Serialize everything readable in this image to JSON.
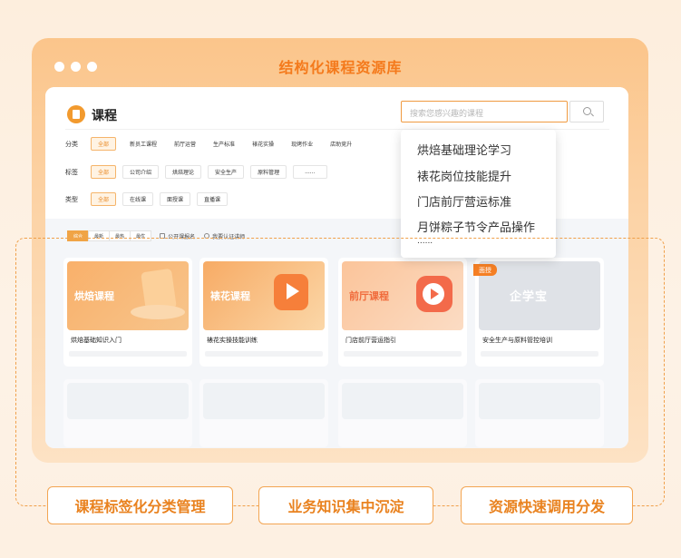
{
  "frame": {
    "title": "结构化课程资源库"
  },
  "header": {
    "title": "课程",
    "search_placeholder": "搜索您感兴趣的课程"
  },
  "filters": [
    {
      "label": "分类",
      "chips": [
        "全部",
        "新员工课程",
        "前厅运营",
        "生产标准",
        "裱花实操",
        "现烤作业",
        "店助竞升"
      ]
    },
    {
      "label": "标签",
      "chips": [
        "全部",
        "公司介绍",
        "烘焙理论",
        "安全生产",
        "原料管理",
        "......"
      ]
    },
    {
      "label": "类型",
      "chips": [
        "全部",
        "在线课",
        "面授课",
        "直播课"
      ]
    }
  ],
  "sort": {
    "options": [
      "综合",
      "最新",
      "最热",
      "最优"
    ],
    "checkbox": "公开课报名",
    "radio": "我要认证讲师"
  },
  "dropdown": {
    "items": [
      "烘焙基础理论学习",
      "裱花岗位技能提升",
      "门店前厅营运标准",
      "月饼粽子节令产品操作"
    ],
    "more": "......"
  },
  "cards": [
    {
      "thumb_label": "烘焙课程",
      "name": "烘焙基础知识入门"
    },
    {
      "thumb_label": "裱花课程",
      "name": "裱花实操技能训练"
    },
    {
      "thumb_label": "前厅课程",
      "name": "门店前厅营运指引"
    },
    {
      "thumb_label": "企学宝",
      "name": "安全生产与原料管控培训",
      "badge": "面授"
    }
  ],
  "pills": [
    "课程标签化分类管理",
    "业务知识集中沉淀",
    "资源快速调用分发"
  ],
  "colors": {
    "accent": "#f0a446",
    "brand_orange": "#f47a1c"
  }
}
